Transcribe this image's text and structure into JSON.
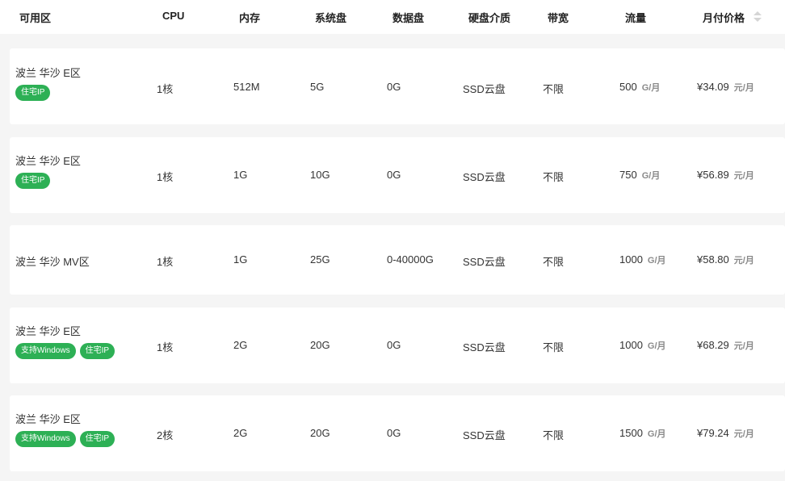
{
  "headers": {
    "zone": "可用区",
    "cpu": "CPU",
    "memory": "内存",
    "system_disk": "系统盘",
    "data_disk": "数据盘",
    "disk_media": "硬盘介质",
    "bandwidth": "带宽",
    "traffic": "流量",
    "monthly_price": "月付价格"
  },
  "units": {
    "traffic": "G/月",
    "price": "元/月"
  },
  "colors": {
    "tag_green": "#2db055",
    "row_bg": "#ffffff",
    "page_bg": "#f5f5f5"
  },
  "rows": [
    {
      "zone": "波兰 华沙 E区",
      "tags": [
        "住宅IP"
      ],
      "cpu": "1核",
      "memory": "512M",
      "system_disk": "5G",
      "data_disk": "0G",
      "disk_media": "SSD云盘",
      "bandwidth": "不限",
      "traffic": "500",
      "price": "¥34.09"
    },
    {
      "zone": "波兰 华沙 E区",
      "tags": [
        "住宅IP"
      ],
      "cpu": "1核",
      "memory": "1G",
      "system_disk": "10G",
      "data_disk": "0G",
      "disk_media": "SSD云盘",
      "bandwidth": "不限",
      "traffic": "750",
      "price": "¥56.89"
    },
    {
      "zone": "波兰 华沙 MV区",
      "tags": [],
      "cpu": "1核",
      "memory": "1G",
      "system_disk": "25G",
      "data_disk": "0-40000G",
      "disk_media": "SSD云盘",
      "bandwidth": "不限",
      "traffic": "1000",
      "price": "¥58.80"
    },
    {
      "zone": "波兰 华沙 E区",
      "tags": [
        "支持Windows",
        "住宅IP"
      ],
      "cpu": "1核",
      "memory": "2G",
      "system_disk": "20G",
      "data_disk": "0G",
      "disk_media": "SSD云盘",
      "bandwidth": "不限",
      "traffic": "1000",
      "price": "¥68.29"
    },
    {
      "zone": "波兰 华沙 E区",
      "tags": [
        "支持Windows",
        "住宅IP"
      ],
      "cpu": "2核",
      "memory": "2G",
      "system_disk": "20G",
      "data_disk": "0G",
      "disk_media": "SSD云盘",
      "bandwidth": "不限",
      "traffic": "1500",
      "price": "¥79.24"
    }
  ]
}
